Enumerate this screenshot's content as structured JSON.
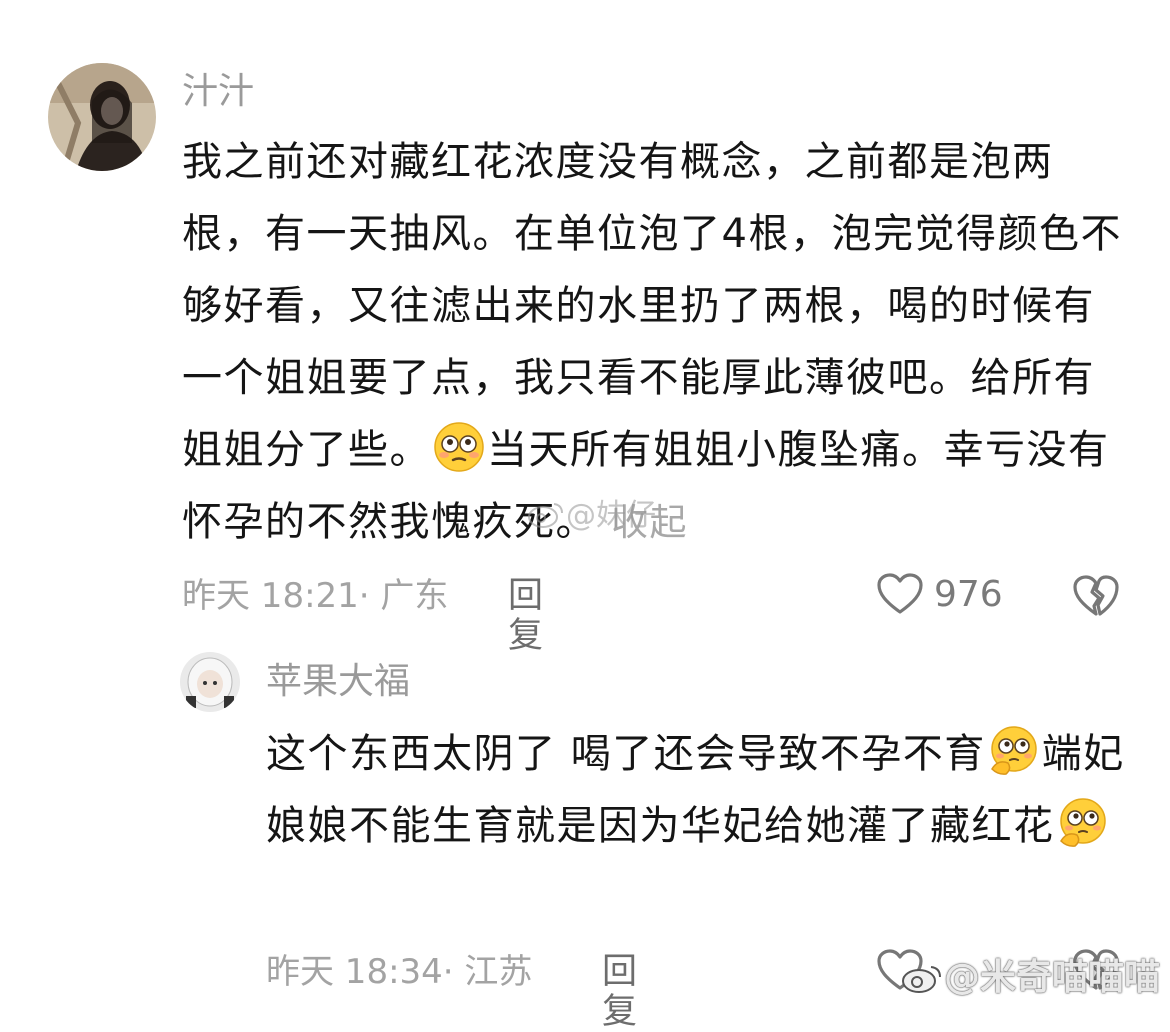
{
  "comments": [
    {
      "username": "汁汁",
      "text_part1": "我之前还对藏红花浓度没有概念，之前都是泡两根，有一天抽风。在单位泡了4根，泡完觉得颜色不够好看，又往滤出来的水里扔了两根，喝的时候有一个姐姐要了点，我只看不能厚此薄彼吧。给所有姐姐分了些。",
      "emoji_1": "flushed-emoji",
      "text_part2": "当天所有姐姐小腹坠痛。幸亏没有怀孕的不然我愧疚死。",
      "collapse_label": "收起",
      "time": "昨天 18:21",
      "location": "· 广东",
      "reply_label": "回复",
      "like_count": "976"
    },
    {
      "username": "苹果大福",
      "text_part1": "这个东西太阴了 喝了还会导致不孕不育",
      "emoji_1": "thinking-flushed-emoji",
      "text_part2": "端妃娘娘不能生育就是因为华妃给她灌了藏红花",
      "emoji_2": "thinking-flushed-emoji",
      "time": "昨天 18:34",
      "location": "· 江苏",
      "reply_label": "回复"
    }
  ],
  "watermarks": {
    "center": "@妹仔",
    "bottom_right": "@米奇喵喵喵"
  },
  "colors": {
    "username": "#9a9a9a",
    "meta": "#a3a3a3",
    "text": "#151515",
    "emoji_face": "#ffcf3a"
  }
}
